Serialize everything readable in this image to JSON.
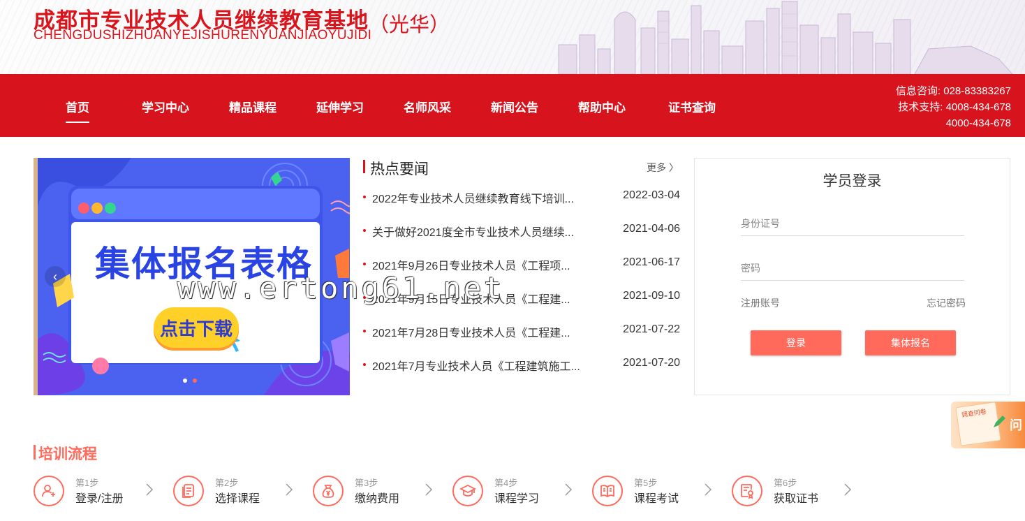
{
  "header": {
    "title": "成都市专业技术人员继续教育基地",
    "pinyin": "CHENGDUSHIZHUANYEJISHURENYUANJIAOYUJIDI",
    "branch": "（光华）"
  },
  "nav": {
    "items": [
      "首页",
      "学习中心",
      "精品课程",
      "延伸学习",
      "名师风采",
      "新闻公告",
      "帮助中心",
      "证书查询"
    ],
    "contact": {
      "info": "信息咨询: 028-83383267",
      "support": "技术支持: 4008-434-678",
      "support2": "4000-434-678"
    }
  },
  "banner": {
    "title": "集体报名表格",
    "button": "点击下载",
    "prev": "‹"
  },
  "news": {
    "title": "热点要闻",
    "more": "更多 〉",
    "items": [
      {
        "text": "2022年专业技术人员继续教育线下培训...",
        "date": "2022-03-04"
      },
      {
        "text": "关于做好2021度全市专业技术人员继续...",
        "date": "2021-04-06"
      },
      {
        "text": "2021年9月26日专业技术人员《工程项...",
        "date": "2021-06-17"
      },
      {
        "text": "2021年9月15日专业技术人员《工程建...",
        "date": "2021-09-10"
      },
      {
        "text": "2021年7月28日专业技术人员《工程建...",
        "date": "2021-07-22"
      },
      {
        "text": "2021年7月专业技术人员《工程建筑施工...",
        "date": "2021-07-20"
      }
    ]
  },
  "watermark": "www.ertong61.net",
  "login": {
    "title": "学员登录",
    "id_placeholder": "身份证号",
    "password_placeholder": "密码",
    "register": "注册账号",
    "forgot": "忘记密码",
    "login_button": "登录",
    "group_button": "集体报名"
  },
  "survey": {
    "paper_text": "调查问卷",
    "label": "问"
  },
  "flow": {
    "title": "培训流程",
    "steps": [
      {
        "num": "第1步",
        "label": "登录/注册",
        "icon": "user-add-icon"
      },
      {
        "num": "第2步",
        "label": "选择课程",
        "icon": "document-icon"
      },
      {
        "num": "第3步",
        "label": "缴纳费用",
        "icon": "money-bag-icon"
      },
      {
        "num": "第4步",
        "label": "课程学习",
        "icon": "graduation-cap-icon"
      },
      {
        "num": "第5步",
        "label": "课程考试",
        "icon": "book-icon"
      },
      {
        "num": "第6步",
        "label": "获取证书",
        "icon": "certificate-icon"
      }
    ]
  },
  "colors": {
    "brand_red": "#d7141d",
    "accent_coral": "#ff6a5b",
    "banner_blue": "#4b62f1"
  }
}
